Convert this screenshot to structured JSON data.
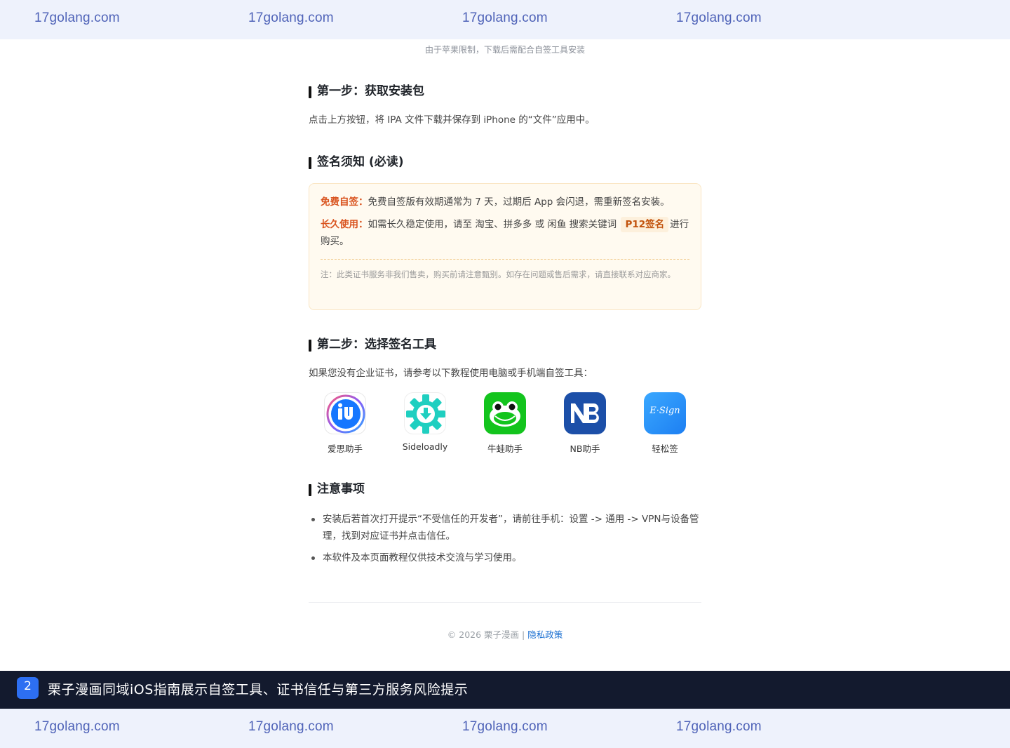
{
  "watermark": {
    "top": [
      "17golang.com",
      "17golang.com",
      "17golang.com",
      "17golang.com"
    ],
    "bottom": [
      "17golang.com",
      "17golang.com",
      "17golang.com",
      "17golang.com"
    ]
  },
  "notice": "由于苹果限制，下载后需配合自签工具安装",
  "step1": {
    "title": "第一步：获取安装包",
    "text": "点击上方按钮，将 IPA 文件下载并保存到 iPhone 的“文件”应用中。"
  },
  "sign_notes": {
    "title": "签名须知 (必读)",
    "free_tag": "免费自签：",
    "free_text": "免费自签版有效期通常为 7 天，过期后 App 会闪退，需重新签名安装。",
    "long_tag": "长久使用：",
    "long_text_a": "如需长久稳定使用，请至 淘宝、拼多多 或 闲鱼 搜索关键词",
    "keyword": "P12签名",
    "long_text_b": "进行购买。",
    "disclaimer": "注：此类证书服务非我们售卖，购买前请注意甄别。如存在问题或售后需求，请直接联系对应商家。"
  },
  "step2": {
    "title": "第二步：选择签名工具",
    "text": "如果您没有企业证书，请参考以下教程使用电脑或手机端自签工具：",
    "tools": [
      {
        "label": "爱思助手",
        "icon": "aisi-icon"
      },
      {
        "label": "Sideloadly",
        "icon": "sideloadly-icon"
      },
      {
        "label": "牛蛙助手",
        "icon": "frog-icon"
      },
      {
        "label": "NB助手",
        "icon": "nb-icon"
      },
      {
        "label": "轻松签",
        "icon": "esign-icon"
      }
    ],
    "esign_text": "E·Sign"
  },
  "cautions": {
    "title": "注意事项",
    "items": [
      "安装后若首次打开提示“不受信任的开发者”，请前往手机：设置 -> 通用 -> VPN与设备管理，找到对应证书并点击信任。",
      "本软件及本页面教程仅供技术交流与学习使用。"
    ]
  },
  "footer": {
    "copyright": "© 2026 栗子漫画 | ",
    "privacy": "隐私政策"
  },
  "caption": {
    "number": "2",
    "title": "栗子漫画同域iOS指南展示自签工具、证书信任与第三方服务风险提示"
  }
}
